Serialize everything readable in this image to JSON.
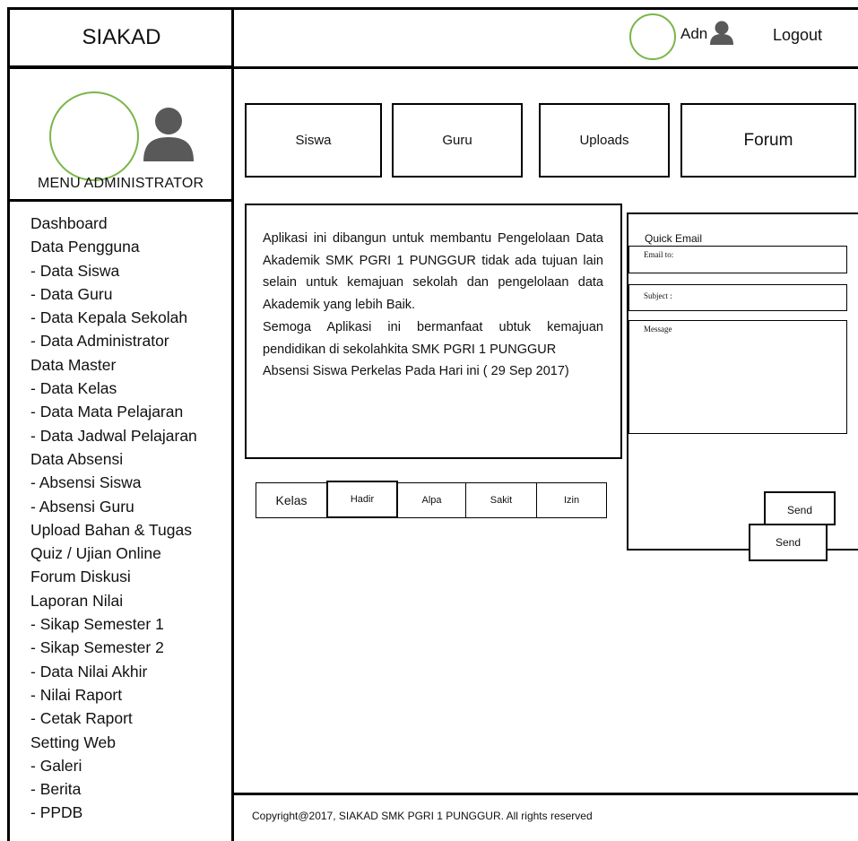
{
  "brand": {
    "title": "SIAKAD"
  },
  "header": {
    "user_label": "Adn",
    "logout_label": "Logout"
  },
  "profile": {
    "menu_title": "MENU ADMINISTRATOR"
  },
  "sidebar": {
    "items": [
      {
        "label": "Dashboard"
      },
      {
        "label": "Data Pengguna"
      },
      {
        "label": "- Data Siswa"
      },
      {
        "label": "- Data Guru"
      },
      {
        "label": "- Data Kepala Sekolah"
      },
      {
        "label": "- Data Administrator"
      },
      {
        "label": "Data Master"
      },
      {
        "label": "- Data Kelas"
      },
      {
        "label": "- Data Mata Pelajaran"
      },
      {
        "label": "- Data Jadwal Pelajaran"
      },
      {
        "label": "Data Absensi"
      },
      {
        "label": "- Absensi Siswa"
      },
      {
        "label": "- Absensi Guru"
      },
      {
        "label": "Upload Bahan & Tugas"
      },
      {
        "label": "Quiz / Ujian Online"
      },
      {
        "label": "Forum Diskusi"
      },
      {
        "label": "Laporan Nilai"
      },
      {
        "label": "- Sikap Semester 1"
      },
      {
        "label": "- Sikap Semester 2"
      },
      {
        "label": "- Data Nilai Akhir"
      },
      {
        "label": "- Nilai Raport"
      },
      {
        "label": "- Cetak Raport"
      },
      {
        "label": "Setting Web"
      },
      {
        "label": "- Galeri"
      },
      {
        "label": "- Berita"
      },
      {
        "label": "- PPDB"
      }
    ]
  },
  "nav": {
    "siswa": "Siswa",
    "guru": "Guru",
    "uploads": "Uploads",
    "forum": "Forum"
  },
  "info": {
    "paragraph1": "Aplikasi ini dibangun untuk membantu Pengelolaan Data Akademik SMK PGRI 1 PUNGGUR tidak ada tujuan lain selain untuk kemajuan sekolah dan pengelolaan data Akademik yang lebih Baik.",
    "paragraph2": "Semoga Aplikasi ini bermanfaat ubtuk kemajuan pendidikan di sekolahkita SMK PGRI 1 PUNGGUR",
    "paragraph3": "Absensi Siswa Perkelas Pada Hari ini ( 29 Sep 2017)"
  },
  "attendance": {
    "kelas": "Kelas",
    "hadir": "Hadir",
    "alpa": "Alpa",
    "sakit": "Sakit",
    "izin": "Izin"
  },
  "quick_email": {
    "title": "Quick Email",
    "email_label": "Email to:",
    "subject_label": "Subject :",
    "message_label": "Message",
    "send_label": "Send",
    "send_label_2": "Send"
  },
  "footer": {
    "text": "Copyright@2017, SIAKAD SMK PGRI 1 PUNGGUR. All rights reserved"
  },
  "colors": {
    "accent_circle": "#7ab648",
    "border": "#000000",
    "icon": "#595959"
  }
}
